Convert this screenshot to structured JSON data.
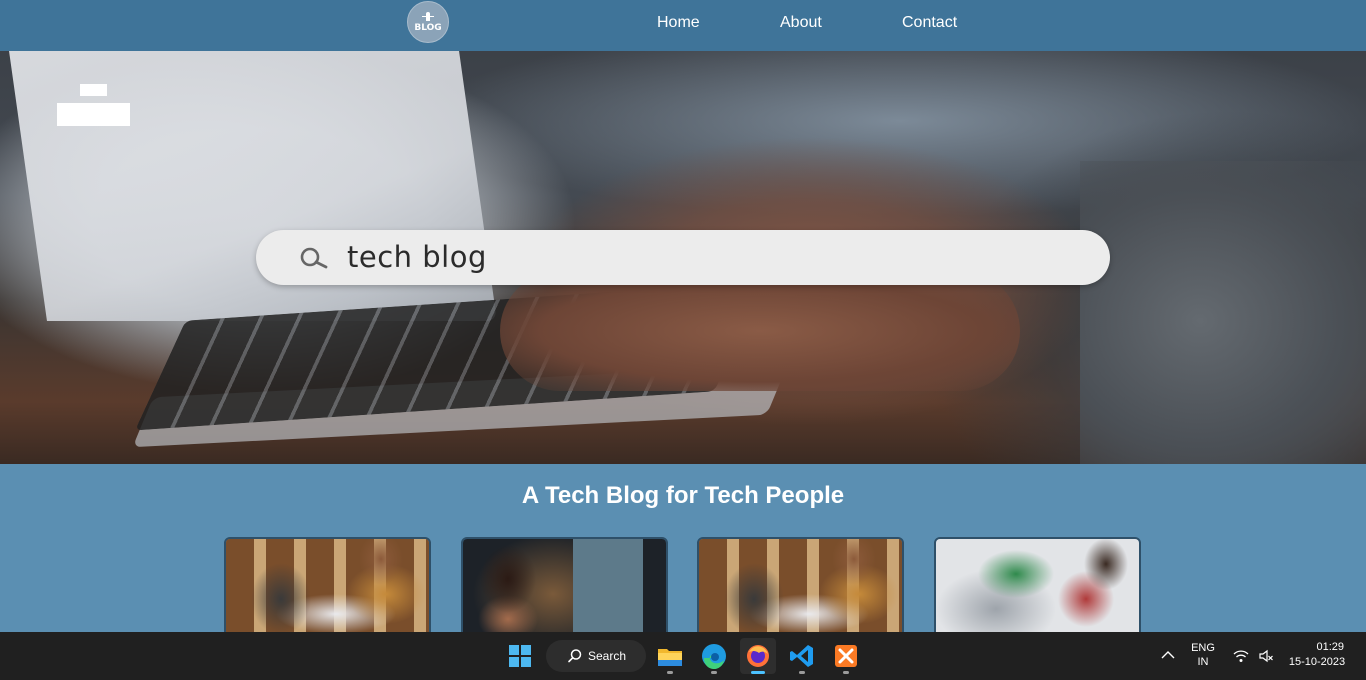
{
  "nav": {
    "logo_text": "BLOG",
    "links": [
      "Home",
      "About",
      "Contact"
    ]
  },
  "hero": {
    "search_value": "tech blog"
  },
  "main": {
    "headline": "A Tech Blog for Tech People",
    "cards": [
      {
        "image": "team-office-photo"
      },
      {
        "image": "developer-night-photo"
      },
      {
        "image": "team-office-photo"
      },
      {
        "image": "electronics-repair-photo"
      }
    ]
  },
  "taskbar": {
    "search_label": "Search",
    "apps": [
      "start",
      "search",
      "file-explorer",
      "edge",
      "firefox",
      "vscode",
      "xampp"
    ],
    "language_line1": "ENG",
    "language_line2": "IN",
    "time": "01:29",
    "date": "15-10-2023"
  }
}
